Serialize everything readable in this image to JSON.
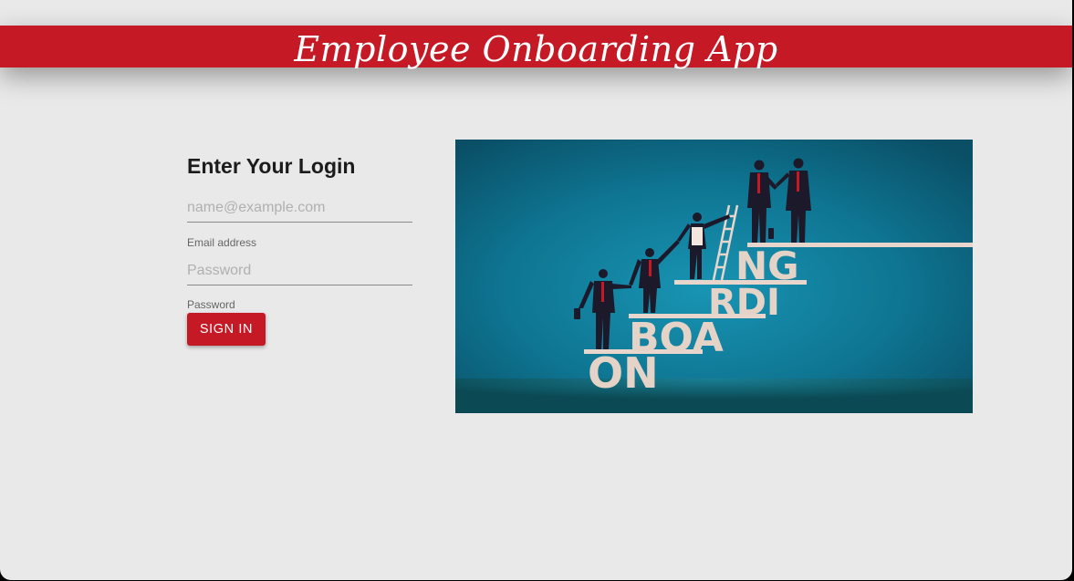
{
  "header": {
    "title": "Employee Onboarding App",
    "background_color": "#c51a25"
  },
  "login": {
    "title": "Enter Your Login",
    "email": {
      "placeholder": "name@example.com",
      "value": "",
      "helper": "Email address"
    },
    "password": {
      "placeholder": "Password",
      "value": "",
      "helper": "Password"
    },
    "signin_label": "SIGN IN"
  },
  "hero_image": {
    "letters": {
      "step1": "ON",
      "step2": "BOA",
      "step3": "RDI",
      "step4": "NG"
    },
    "background_color": "#0c6f8a"
  }
}
